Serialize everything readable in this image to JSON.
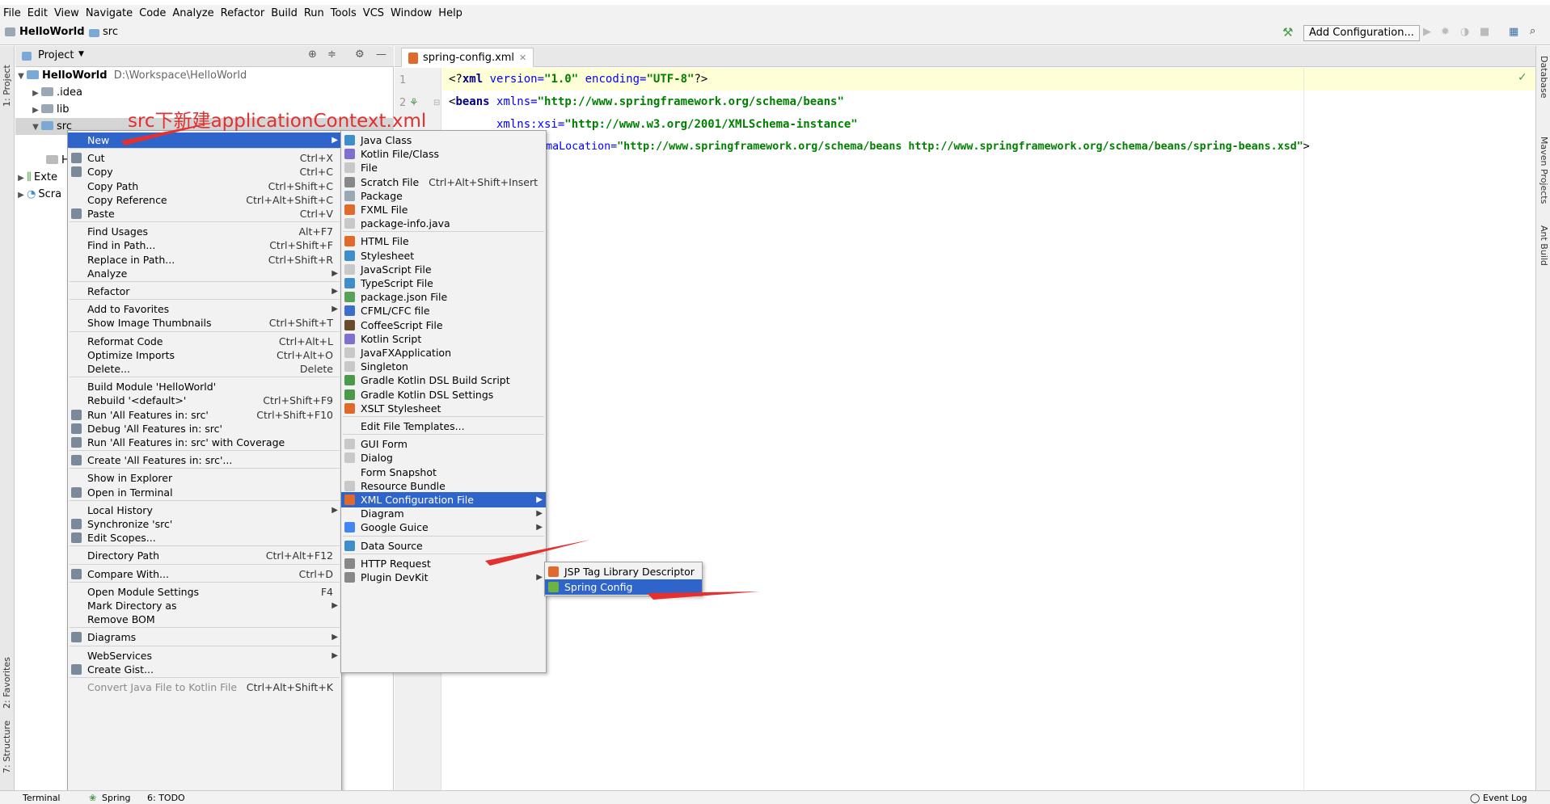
{
  "menubar": [
    "File",
    "Edit",
    "View",
    "Navigate",
    "Code",
    "Analyze",
    "Refactor",
    "Build",
    "Run",
    "Tools",
    "VCS",
    "Window",
    "Help"
  ],
  "navbar": {
    "project": "HelloWorld",
    "folder": "src",
    "add_config": "Add Configuration..."
  },
  "left_strip": {
    "project": "1: Project",
    "favorites": "2: Favorites",
    "structure": "7: Structure"
  },
  "right_strip": {
    "database": "Database",
    "maven": "Maven Projects",
    "ant": "Ant Build"
  },
  "project_panel": {
    "header": "Project",
    "root_name": "HelloWorld",
    "root_path": "D:\\Workspace\\HelloWorld",
    "idea": ".idea",
    "lib": "lib",
    "src": "src",
    "ext": "Exte",
    "scra": "Scra",
    "h": "H"
  },
  "editor": {
    "tab": "spring-config.xml",
    "line_numbers": [
      "1",
      "2"
    ],
    "lines": [
      {
        "a": "<?",
        "b": "xml",
        "c": " version=",
        "d": "\"1.0\"",
        "e": " encoding=",
        "f": "\"UTF-8\"",
        "g": "?>"
      },
      {
        "a": "<",
        "b": "beans",
        "c": " xmlns=",
        "d": "\"http://www.springframework.org/schema/beans\""
      },
      {
        "c": "       xmlns:xsi=",
        "d": "\"http://www.w3.org/2001/XMLSchema-instance\""
      },
      {
        "c": "       xsi:schemaLocation=",
        "d": "\"http://www.springframework.org/schema/beans http://www.springframework.org/schema/beans/spring-beans.xsd\"",
        "g": ">"
      }
    ]
  },
  "annotation": "src下新建applicationContext.xml",
  "context_menu": [
    {
      "label": "New",
      "sub": true,
      "sel": true
    },
    {
      "sep": true
    },
    {
      "label": "Cut",
      "sc": "Ctrl+X",
      "icon": "scissors-icon"
    },
    {
      "label": "Copy",
      "sc": "Ctrl+C",
      "icon": "copy-icon"
    },
    {
      "label": "Copy Path",
      "sc": "Ctrl+Shift+C"
    },
    {
      "label": "Copy Reference",
      "sc": "Ctrl+Alt+Shift+C"
    },
    {
      "label": "Paste",
      "sc": "Ctrl+V",
      "icon": "paste-icon"
    },
    {
      "sep": true
    },
    {
      "label": "Find Usages",
      "sc": "Alt+F7"
    },
    {
      "label": "Find in Path...",
      "sc": "Ctrl+Shift+F"
    },
    {
      "label": "Replace in Path...",
      "sc": "Ctrl+Shift+R"
    },
    {
      "label": "Analyze",
      "sub": true
    },
    {
      "sep": true
    },
    {
      "label": "Refactor",
      "sub": true
    },
    {
      "sep": true
    },
    {
      "label": "Add to Favorites",
      "sub": true
    },
    {
      "label": "Show Image Thumbnails",
      "sc": "Ctrl+Shift+T"
    },
    {
      "sep": true
    },
    {
      "label": "Reformat Code",
      "sc": "Ctrl+Alt+L"
    },
    {
      "label": "Optimize Imports",
      "sc": "Ctrl+Alt+O"
    },
    {
      "label": "Delete...",
      "sc": "Delete"
    },
    {
      "sep": true
    },
    {
      "label": "Build Module 'HelloWorld'"
    },
    {
      "label": "Rebuild '<default>'",
      "sc": "Ctrl+Shift+F9"
    },
    {
      "label": "Run 'All Features in: src'",
      "sc": "Ctrl+Shift+F10",
      "icon": "run-icon"
    },
    {
      "label": "Debug 'All Features in: src'",
      "icon": "debug-icon"
    },
    {
      "label": "Run 'All Features in: src' with Coverage",
      "icon": "coverage-icon"
    },
    {
      "sep": true
    },
    {
      "label": "Create 'All Features in: src'...",
      "icon": "create-icon"
    },
    {
      "sep": true
    },
    {
      "label": "Show in Explorer"
    },
    {
      "label": "Open in Terminal",
      "icon": "terminal-icon"
    },
    {
      "sep": true
    },
    {
      "label": "Local History",
      "sub": true
    },
    {
      "label": "Synchronize 'src'",
      "icon": "sync-icon"
    },
    {
      "label": "Edit Scopes...",
      "icon": "scopes-icon"
    },
    {
      "sep": true
    },
    {
      "label": "Directory Path",
      "sc": "Ctrl+Alt+F12"
    },
    {
      "sep": true
    },
    {
      "label": "Compare With...",
      "sc": "Ctrl+D",
      "icon": "compare-icon"
    },
    {
      "sep": true
    },
    {
      "label": "Open Module Settings",
      "sc": "F4"
    },
    {
      "label": "Mark Directory as",
      "sub": true
    },
    {
      "label": "Remove BOM"
    },
    {
      "sep": true
    },
    {
      "label": "Diagrams",
      "sub": true,
      "icon": "diagram-icon"
    },
    {
      "sep": true
    },
    {
      "label": "WebServices",
      "sub": true
    },
    {
      "label": "Create Gist...",
      "icon": "github-icon"
    },
    {
      "sep": true
    },
    {
      "label": "Convert Java File to Kotlin File",
      "sc": "Ctrl+Alt+Shift+K",
      "dis": true
    }
  ],
  "new_menu": [
    {
      "label": "Java Class",
      "icon": "java-class-icon",
      "color": "#3d8ec9"
    },
    {
      "label": "Kotlin File/Class",
      "icon": "kotlin-icon",
      "color": "#7f6fcf"
    },
    {
      "label": "File",
      "icon": "file-icon",
      "color": "#c8c8c8"
    },
    {
      "label": "Scratch File",
      "sc": "Ctrl+Alt+Shift+Insert",
      "icon": "scratch-icon",
      "color": "#888"
    },
    {
      "label": "Package",
      "icon": "package-icon",
      "color": "#9aa7b5"
    },
    {
      "label": "FXML File",
      "icon": "fxml-icon",
      "color": "#e06a2c"
    },
    {
      "label": "package-info.java",
      "icon": "java-file-icon",
      "color": "#c8c8c8"
    },
    {
      "sep": true
    },
    {
      "label": "HTML File",
      "icon": "html-icon",
      "color": "#e06a2c"
    },
    {
      "label": "Stylesheet",
      "icon": "css-icon",
      "color": "#3d8ec9"
    },
    {
      "label": "JavaScript File",
      "icon": "js-icon",
      "color": "#c8c8c8"
    },
    {
      "label": "TypeScript File",
      "icon": "ts-icon",
      "color": "#3d8ec9"
    },
    {
      "label": "package.json File",
      "icon": "npm-icon",
      "color": "#5aa05a"
    },
    {
      "label": "CFML/CFC file",
      "icon": "cfml-icon",
      "color": "#3d6ec9"
    },
    {
      "label": "CoffeeScript File",
      "icon": "coffee-icon",
      "color": "#6a4a2c"
    },
    {
      "label": "Kotlin Script",
      "icon": "kotlin-script-icon",
      "color": "#7f6fcf"
    },
    {
      "label": "JavaFXApplication",
      "icon": "javafx-icon",
      "color": "#c8c8c8"
    },
    {
      "label": "Singleton",
      "icon": "singleton-icon",
      "color": "#c8c8c8"
    },
    {
      "label": "Gradle Kotlin DSL Build Script",
      "icon": "gradle-icon",
      "color": "#4a9a4a"
    },
    {
      "label": "Gradle Kotlin DSL Settings",
      "icon": "gradle-settings-icon",
      "color": "#4a9a4a"
    },
    {
      "label": "XSLT Stylesheet",
      "icon": "xslt-icon",
      "color": "#e06a2c"
    },
    {
      "sep": true
    },
    {
      "label": "Edit File Templates..."
    },
    {
      "sep": true
    },
    {
      "label": "GUI Form",
      "icon": "gui-form-icon",
      "color": "#c8c8c8"
    },
    {
      "label": "Dialog",
      "icon": "dialog-icon",
      "color": "#c8c8c8"
    },
    {
      "label": "Form Snapshot"
    },
    {
      "label": "Resource Bundle",
      "icon": "bundle-icon",
      "color": "#c8c8c8"
    },
    {
      "label": "XML Configuration File",
      "sub": true,
      "sel": true,
      "icon": "xml-config-icon",
      "color": "#e06a2c"
    },
    {
      "label": "Diagram",
      "sub": true
    },
    {
      "label": "Google Guice",
      "sub": true,
      "icon": "google-icon",
      "color": "#4285f4"
    },
    {
      "sep": true
    },
    {
      "label": "Data Source",
      "icon": "datasource-icon",
      "color": "#3d8ec9"
    },
    {
      "sep": true
    },
    {
      "label": "HTTP Request",
      "icon": "http-icon",
      "color": "#888"
    },
    {
      "label": "Plugin DevKit",
      "sub": true,
      "icon": "devkit-icon",
      "color": "#888"
    }
  ],
  "xml_menu": [
    {
      "label": "JSP Tag Library Descriptor",
      "icon": "jsp-icon",
      "color": "#e06a2c"
    },
    {
      "label": "Spring Config",
      "sel": true,
      "icon": "spring-icon",
      "color": "#6db33f"
    }
  ],
  "bottombar": {
    "terminal": "Terminal",
    "spring": "Spring",
    "todo": "6: TODO",
    "event_log": "Event Log"
  }
}
